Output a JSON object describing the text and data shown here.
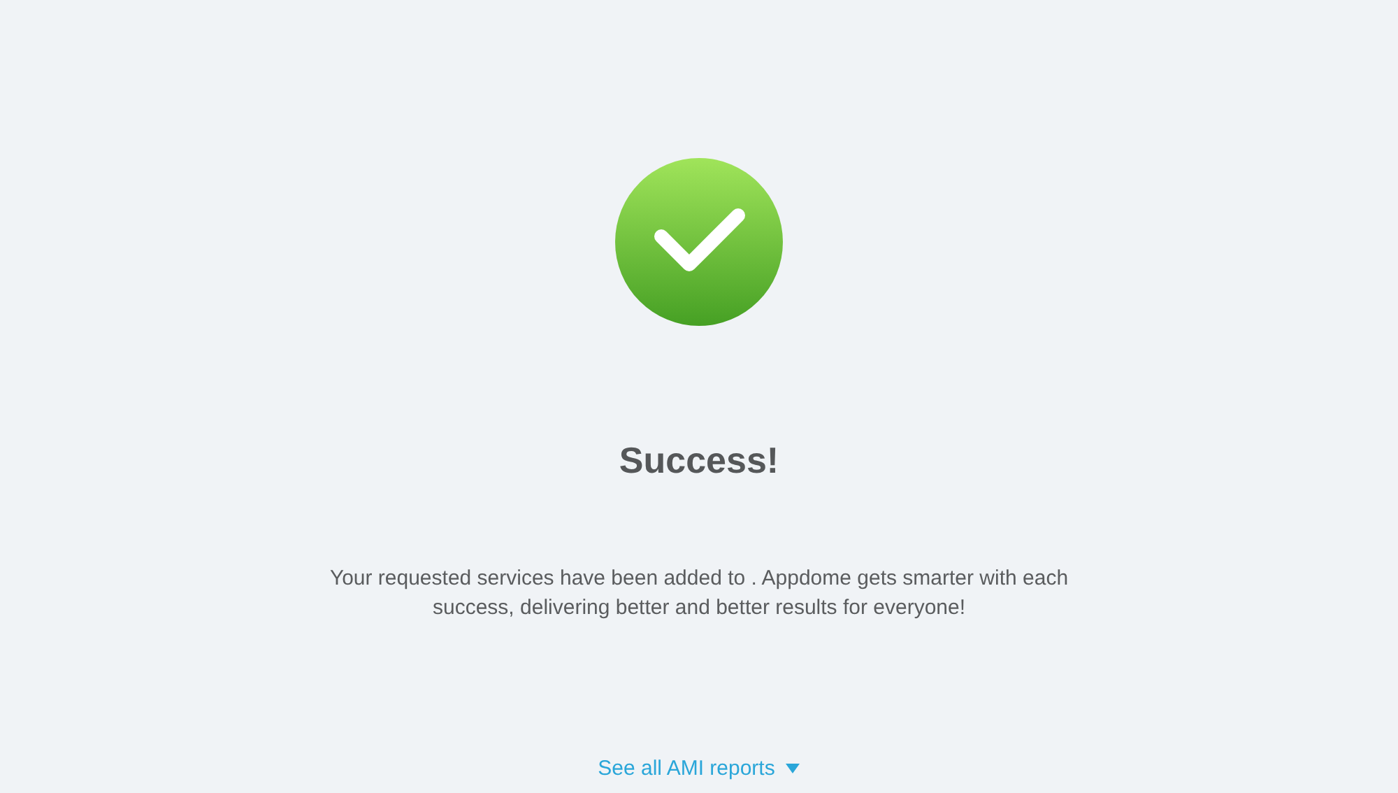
{
  "status": {
    "kind": "success",
    "title": "Success!",
    "message": "Your requested services have been added to . Appdome gets smarter with each success, delivering better and better results for everyone!"
  },
  "reports_link": {
    "label": "See all AMI reports",
    "expanded": false
  }
}
